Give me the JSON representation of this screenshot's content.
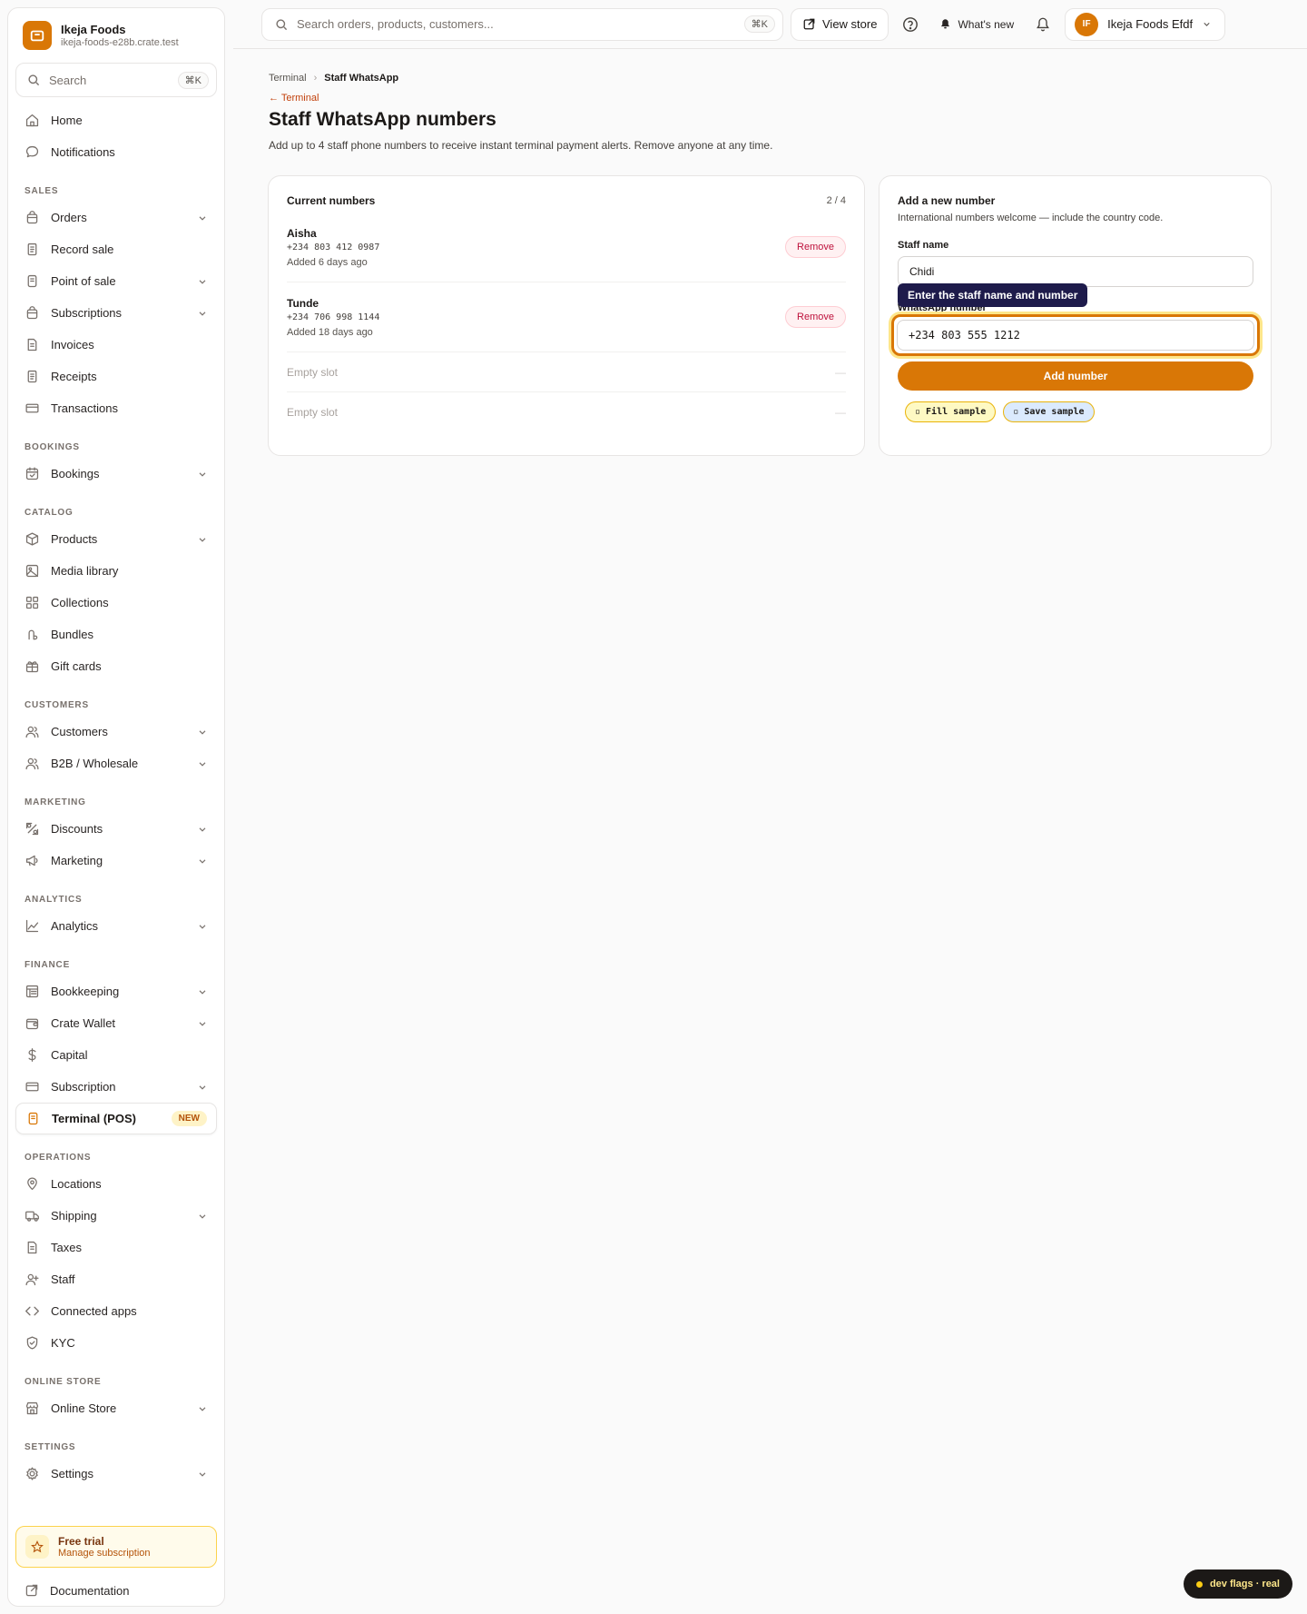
{
  "brand": {
    "name": "Ikeja Foods",
    "domain": "ikeja-foods-e28b.crate.test",
    "accent": "#d97706"
  },
  "sidebar": {
    "search_label": "Search",
    "search_kbd": "⌘K",
    "top_items": [
      {
        "label": "Home",
        "icon": "home-icon"
      },
      {
        "label": "Notifications",
        "icon": "chat-bubble-icon"
      }
    ],
    "sections": [
      {
        "title": "SALES",
        "items": [
          {
            "label": "Orders",
            "icon": "bag-icon",
            "chevron": true
          },
          {
            "label": "Record sale",
            "icon": "receipt-icon",
            "chevron": false
          },
          {
            "label": "Point of sale",
            "icon": "terminal-icon",
            "chevron": true
          },
          {
            "label": "Subscriptions",
            "icon": "bag-icon",
            "chevron": true
          },
          {
            "label": "Invoices",
            "icon": "document-icon",
            "chevron": false
          },
          {
            "label": "Receipts",
            "icon": "receipt-icon",
            "chevron": false
          },
          {
            "label": "Transactions",
            "icon": "card-icon",
            "chevron": false
          }
        ]
      },
      {
        "title": "BOOKINGS",
        "items": [
          {
            "label": "Bookings",
            "icon": "calendar-icon",
            "chevron": true
          }
        ]
      },
      {
        "title": "CATALOG",
        "items": [
          {
            "label": "Products",
            "icon": "box-icon",
            "chevron": true
          },
          {
            "label": "Media library",
            "icon": "image-icon",
            "chevron": false
          },
          {
            "label": "Collections",
            "icon": "grid-icon",
            "chevron": false
          },
          {
            "label": "Bundles",
            "icon": "bundle-icon",
            "chevron": false
          },
          {
            "label": "Gift cards",
            "icon": "gift-icon",
            "chevron": false
          }
        ]
      },
      {
        "title": "CUSTOMERS",
        "items": [
          {
            "label": "Customers",
            "icon": "users-icon",
            "chevron": true
          },
          {
            "label": "B2B / Wholesale",
            "icon": "users-icon",
            "chevron": true
          }
        ]
      },
      {
        "title": "MARKETING",
        "items": [
          {
            "label": "Discounts",
            "icon": "discount-icon",
            "chevron": true
          },
          {
            "label": "Marketing",
            "icon": "megaphone-icon",
            "chevron": true
          }
        ]
      },
      {
        "title": "ANALYTICS",
        "items": [
          {
            "label": "Analytics",
            "icon": "chart-icon",
            "chevron": true
          }
        ]
      },
      {
        "title": "FINANCE",
        "items": [
          {
            "label": "Bookkeeping",
            "icon": "ledger-icon",
            "chevron": true
          },
          {
            "label": "Crate Wallet",
            "icon": "wallet-icon",
            "chevron": true
          },
          {
            "label": "Capital",
            "icon": "dollar-icon",
            "chevron": false
          },
          {
            "label": "Subscription",
            "icon": "card-icon",
            "chevron": true
          },
          {
            "label": "Terminal (POS)",
            "icon": "terminal-icon",
            "chevron": false,
            "active": true,
            "badge": "NEW"
          }
        ]
      },
      {
        "title": "OPERATIONS",
        "items": [
          {
            "label": "Locations",
            "icon": "pin-icon",
            "chevron": false
          },
          {
            "label": "Shipping",
            "icon": "truck-icon",
            "chevron": true
          },
          {
            "label": "Taxes",
            "icon": "document-icon",
            "chevron": false
          },
          {
            "label": "Staff",
            "icon": "user-plus-icon",
            "chevron": false
          },
          {
            "label": "Connected apps",
            "icon": "code-icon",
            "chevron": false
          },
          {
            "label": "KYC",
            "icon": "shield-icon",
            "chevron": false
          }
        ]
      },
      {
        "title": "ONLINE STORE",
        "items": [
          {
            "label": "Online Store",
            "icon": "store-icon",
            "chevron": true
          }
        ]
      },
      {
        "title": "SETTINGS",
        "items": [
          {
            "label": "Settings",
            "icon": "gear-icon",
            "chevron": true
          }
        ]
      }
    ],
    "trial": {
      "title": "Free trial",
      "link": "Manage subscription"
    },
    "docs": "Documentation"
  },
  "topbar": {
    "search_placeholder": "Search orders, products, customers...",
    "search_kbd": "⌘K",
    "view_store": "View store",
    "whats_new": "What's new",
    "account_initials": "IF",
    "account_name": "Ikeja Foods Efdf"
  },
  "page": {
    "breadcrumb_parent": "Terminal",
    "breadcrumb_current": "Staff WhatsApp",
    "back_link": "← Terminal",
    "title": "Staff WhatsApp numbers",
    "subtitle": "Add up to 4 staff phone numbers to receive instant terminal payment alerts. Remove anyone at any time."
  },
  "current": {
    "title": "Current numbers",
    "count": "2 / 4",
    "entries": [
      {
        "name": "Aisha",
        "phone": "+234 803 412 0987",
        "added": "Added 6 days ago",
        "action": "Remove"
      },
      {
        "name": "Tunde",
        "phone": "+234 706 998 1144",
        "added": "Added 18 days ago",
        "action": "Remove"
      }
    ],
    "empty_label": "Empty slot",
    "empty_dash": "—"
  },
  "add_form": {
    "title": "Add a new number",
    "description": "International numbers welcome — include the country code.",
    "name_label": "Staff name",
    "name_value": "Chidi",
    "phone_label": "WhatsApp number",
    "phone_value": "+234 803 555 1212",
    "tooltip": "Enter the staff name and number",
    "submit": "Add number",
    "dev_fill": "▫ Fill sample",
    "dev_save": "▫ Save sample"
  },
  "devflag": "dev flags · real"
}
